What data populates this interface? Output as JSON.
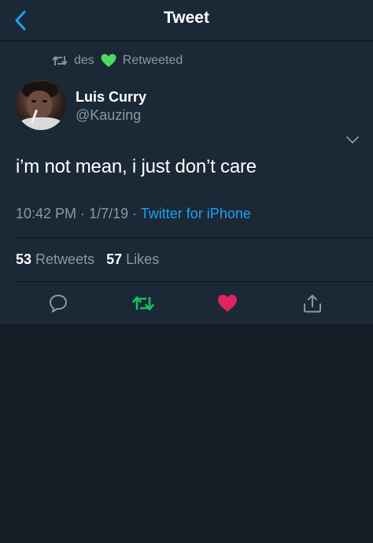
{
  "header": {
    "title": "Tweet",
    "back_icon": "chevron-left-icon",
    "accent": "#1da1f2"
  },
  "tweet": {
    "retweeted_by": "des",
    "retweeted_label": "Retweeted",
    "heart_emoji_color": "#4cd964",
    "author_name": "Luis Curry",
    "author_handle": "@Kauzing",
    "text": "i’m not mean, i just don’t care",
    "time": "10:42 PM",
    "date": "1/7/19",
    "source": "Twitter for iPhone",
    "retweets_count": "53",
    "retweets_label": "Retweets",
    "likes_count": "57",
    "likes_label": "Likes"
  },
  "actions": {
    "retweet_color": "#17bf63",
    "like_color": "#e0245e",
    "icon_color": "#8899a6"
  }
}
